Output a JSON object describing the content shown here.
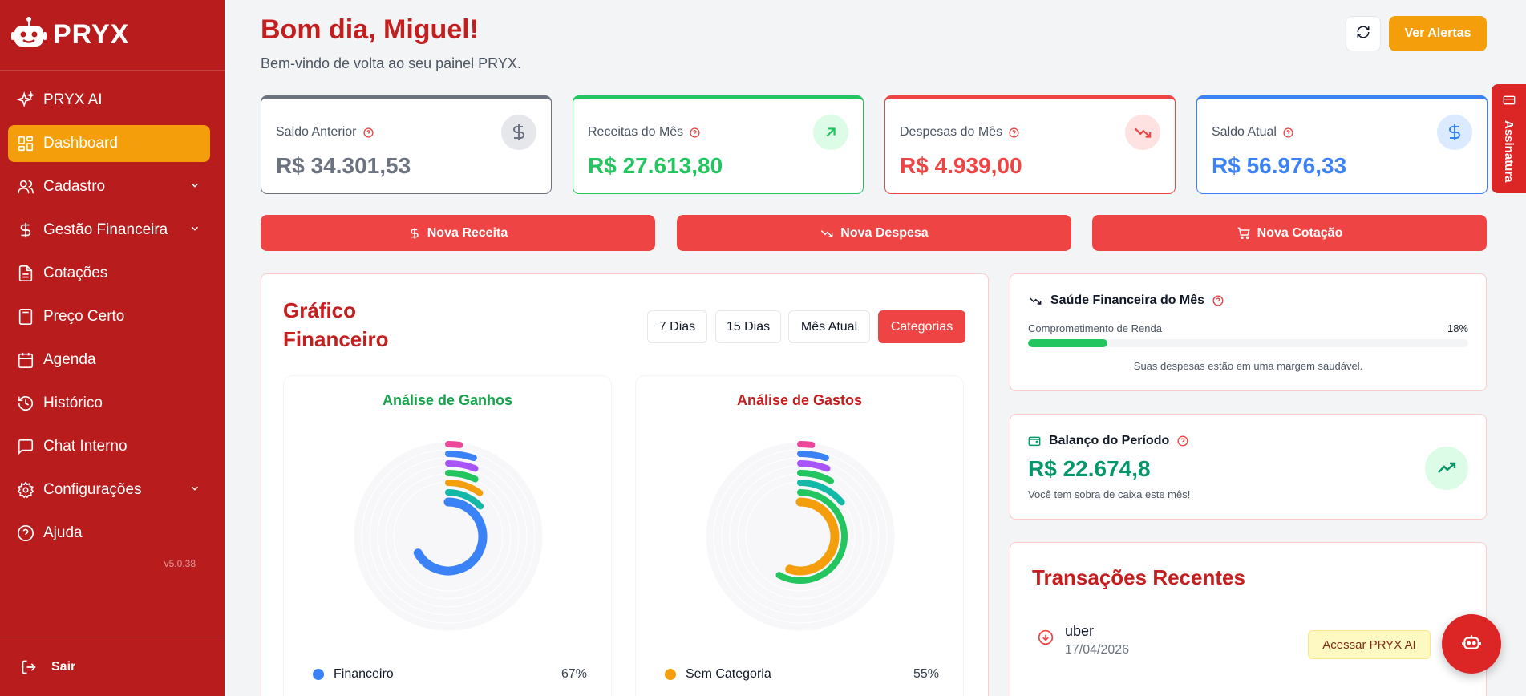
{
  "brand": {
    "name": "PRYX"
  },
  "sidebar": {
    "items": [
      {
        "label": "PRYX AI"
      },
      {
        "label": "Dashboard"
      },
      {
        "label": "Cadastro"
      },
      {
        "label": "Gestão Financeira"
      },
      {
        "label": "Cotações"
      },
      {
        "label": "Preço Certo"
      },
      {
        "label": "Agenda"
      },
      {
        "label": "Histórico"
      },
      {
        "label": "Chat Interno"
      },
      {
        "label": "Configurações"
      },
      {
        "label": "Ajuda"
      }
    ],
    "version": "v5.0.38",
    "logout": "Sair"
  },
  "header": {
    "greeting": "Bom dia, Miguel!",
    "subtitle": "Bem-vindo de volta ao seu painel PRYX.",
    "alerts_button": "Ver Alertas"
  },
  "side_tab": {
    "label": "Assinatura"
  },
  "stats": [
    {
      "title": "Saldo Anterior",
      "value": "R$ 34.301,53",
      "color": "#6b7280"
    },
    {
      "title": "Receitas do Mês",
      "value": "R$ 27.613,80",
      "color": "#22c55e"
    },
    {
      "title": "Despesas do Mês",
      "value": "R$ 4.939,00",
      "color": "#ef4444"
    },
    {
      "title": "Saldo Atual",
      "value": "R$ 56.976,33",
      "color": "#3b82f6"
    }
  ],
  "actions": [
    {
      "label": "Nova Receita"
    },
    {
      "label": "Nova Despesa"
    },
    {
      "label": "Nova Cotação"
    }
  ],
  "chart_panel": {
    "title_line1": "Gráfico",
    "title_line2": "Financeiro",
    "filters": [
      "7 Dias",
      "15 Dias",
      "Mês Atual",
      "Categorias"
    ],
    "active_filter": "Categorias"
  },
  "chart_data": [
    {
      "type": "radial-bar",
      "title": "Análise de Ganhos",
      "legend": [
        {
          "name": "Financeiro",
          "percent": 67
        }
      ],
      "rings": [
        {
          "percent": 67,
          "color": "#3b82f6"
        },
        {
          "percent": 13,
          "color": "#14b8a6"
        },
        {
          "percent": 10,
          "color": "#f59e0b"
        },
        {
          "percent": 7,
          "color": "#22c55e"
        },
        {
          "percent": 6,
          "color": "#a855f7"
        },
        {
          "percent": 5,
          "color": "#3b82f6"
        },
        {
          "percent": 2,
          "color": "#ec4899"
        }
      ]
    },
    {
      "type": "radial-bar",
      "title": "Análise de Gastos",
      "legend": [
        {
          "name": "Sem Categoria",
          "percent": 55
        }
      ],
      "rings": [
        {
          "percent": 55,
          "color": "#f59e0b"
        },
        {
          "percent": 58,
          "color": "#22c55e"
        },
        {
          "percent": 14,
          "color": "#14b8a6"
        },
        {
          "percent": 8,
          "color": "#22c55e"
        },
        {
          "percent": 6,
          "color": "#a855f7"
        },
        {
          "percent": 5,
          "color": "#3b82f6"
        },
        {
          "percent": 2,
          "color": "#ec4899"
        }
      ]
    }
  ],
  "health": {
    "title": "Saúde Financeira do Mês",
    "label": "Comprometimento de Renda",
    "percent_text": "18%",
    "percent": 18,
    "message": "Suas despesas estão em uma margem saudável."
  },
  "balance": {
    "title": "Balanço do Período",
    "value": "R$ 22.674,8",
    "message": "Você tem sobra de caixa este mês!"
  },
  "transactions": {
    "title": "Transações Recentes",
    "items": [
      {
        "name": "uber",
        "date": "17/04/2026"
      }
    ]
  },
  "ai": {
    "tooltip": "Acessar PRYX AI"
  }
}
